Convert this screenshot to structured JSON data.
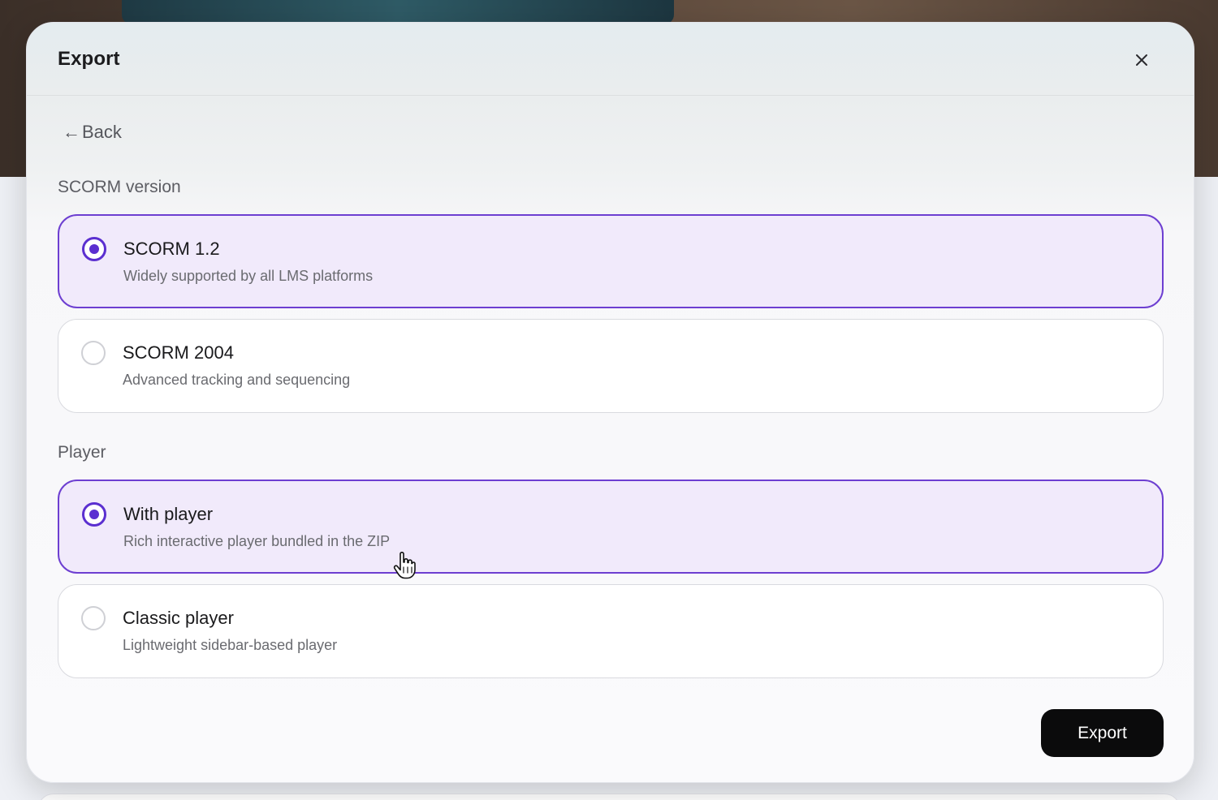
{
  "dialog": {
    "title": "Export",
    "back_label": "Back",
    "export_label": "Export"
  },
  "scorm": {
    "label": "SCORM version",
    "options": [
      {
        "title": "SCORM 1.2",
        "description": "Widely supported by all LMS platforms",
        "selected": true
      },
      {
        "title": "SCORM 2004",
        "description": "Advanced tracking and sequencing",
        "selected": false
      }
    ]
  },
  "player": {
    "label": "Player",
    "options": [
      {
        "title": "With player",
        "description": "Rich interactive player bundled in the ZIP",
        "selected": true
      },
      {
        "title": "Classic player",
        "description": "Lightweight sidebar-based player",
        "selected": false
      }
    ]
  },
  "colors": {
    "accent": "#5b2fd0",
    "selected_bg": "#f1eafb",
    "primary_button": "#0b0b0c"
  },
  "icons": {
    "close": "close-icon",
    "back": "arrow-left-icon",
    "cursor": "hand-pointer-icon"
  }
}
